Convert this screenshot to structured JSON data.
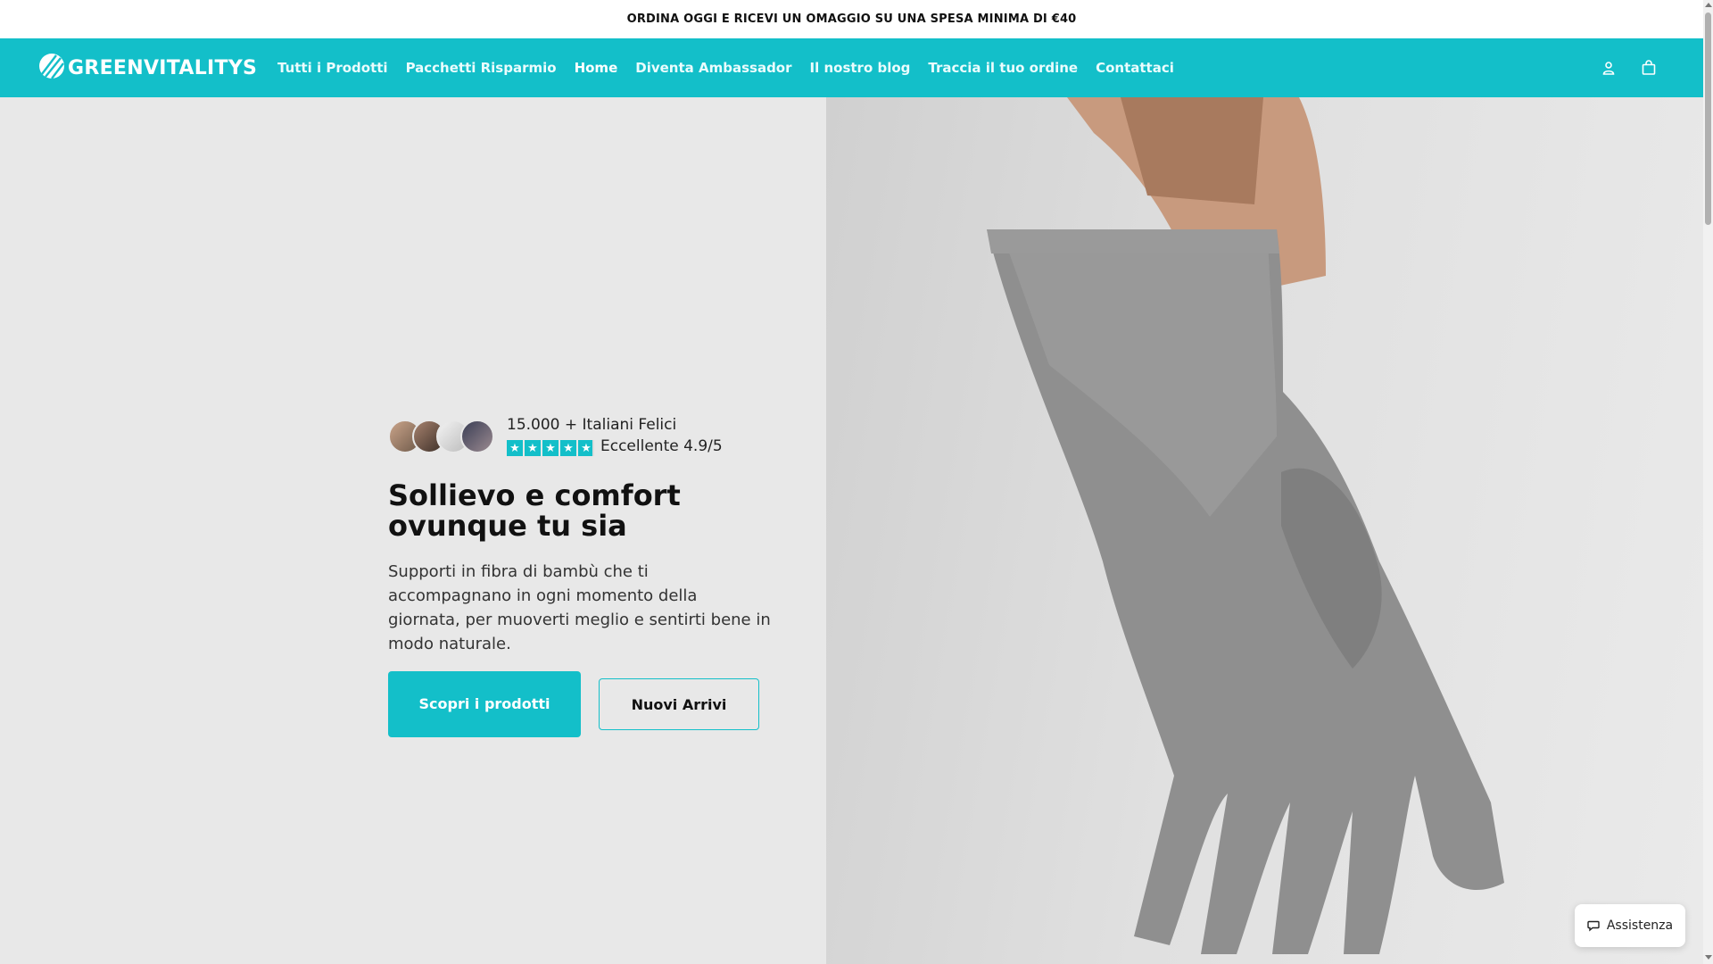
{
  "announcement": "ORDINA OGGI E RICEVI UN OMAGGIO SU UNA SPESA MINIMA DI €40",
  "brand": {
    "name": "GREENVITALITYS",
    "accent_color": "#13bfc9"
  },
  "nav": {
    "links": [
      {
        "label": "Tutti i Prodotti",
        "active": false
      },
      {
        "label": "Pacchetti Risparmio",
        "active": false
      },
      {
        "label": "Home",
        "active": true
      },
      {
        "label": "Diventa Ambassador",
        "active": false
      },
      {
        "label": "Il nostro blog",
        "active": false
      },
      {
        "label": "Traccia il tuo ordine",
        "active": false
      },
      {
        "label": "Contattaci",
        "active": false
      }
    ],
    "icons": [
      "account-icon",
      "cart-icon"
    ]
  },
  "hero": {
    "social_proof": "15.000 + Italiani Felici",
    "rating_label": "Eccellente 4.9/5",
    "rating_value": 4.9,
    "rating_max": 5,
    "headline": "Sollievo e comfort ovunque tu sia",
    "subtext": "Supporti in fibra di bambù che ti accompagnano in ogni momento della giornata, per muoverti meglio e sentirti bene in modo naturale.",
    "primary_cta": "Scopri i prodotti",
    "secondary_cta": "Nuovi Arrivi"
  },
  "help_widget": {
    "label": "Assistenza"
  }
}
